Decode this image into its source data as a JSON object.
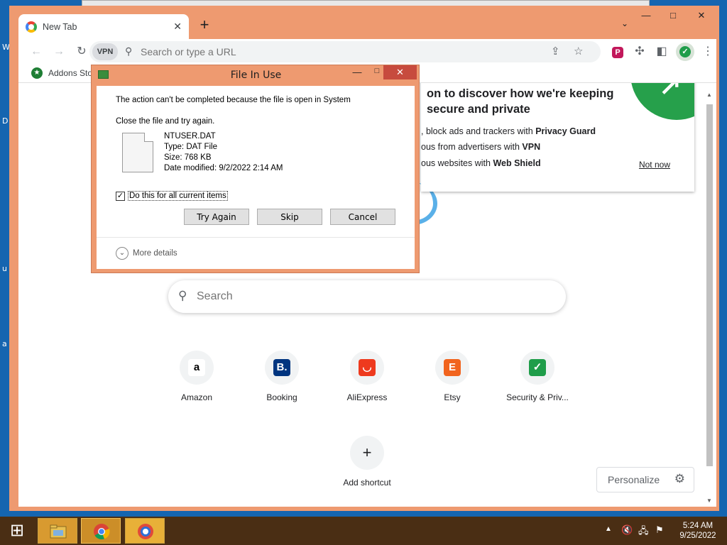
{
  "desktop": {
    "edge_letters": [
      "W",
      "D",
      "u",
      "a"
    ]
  },
  "browser": {
    "tab": {
      "title": "New Tab",
      "close": "✕"
    },
    "new_tab": "+",
    "tab_menu": "⌄",
    "window_controls": {
      "minimize": "—",
      "maximize": "□",
      "close": "✕"
    },
    "toolbar": {
      "back": "←",
      "forward": "→",
      "reload": "↻",
      "vpn_badge": "VPN",
      "omnibox_placeholder": "Search or type a URL",
      "share": "⇪",
      "bookmark_star": "☆",
      "extension_p": "P",
      "extensions": "✣",
      "side_panel": "◧",
      "shield": "✓",
      "menu": "⋮"
    },
    "bookmarks": [
      {
        "label": "Addons Store"
      }
    ],
    "vpn_popup": {
      "title_line1": "on to discover how we're keeping",
      "title_line2": "secure and private",
      "line1_text": ", block ads and trackers with ",
      "line1_bold": "Privacy Guard",
      "line2_text": "ous from advertisers with ",
      "line2_bold": "VPN",
      "line3_text": "ous websites with ",
      "line3_bold": "Web Shield",
      "not_now": "Not now",
      "arrow": "↗"
    },
    "ntp": {
      "search_placeholder": "Search",
      "shortcuts": [
        {
          "label": "Amazon",
          "glyph": "a",
          "color": "#ffffff",
          "text_color": "#000000"
        },
        {
          "label": "Booking",
          "glyph": "B.",
          "color": "#003580",
          "text_color": "#ffffff"
        },
        {
          "label": "AliExpress",
          "glyph": "◡",
          "color": "#ee3a1e",
          "text_color": "#ffffff"
        },
        {
          "label": "Etsy",
          "glyph": "E",
          "color": "#f1641e",
          "text_color": "#ffffff"
        },
        {
          "label": "Security & Priv...",
          "glyph": "✓",
          "color": "#1f9d4a",
          "text_color": "#ffffff"
        }
      ],
      "add_shortcut": {
        "label": "Add shortcut",
        "glyph": "+"
      },
      "personalize": "Personalize",
      "personalize_icon": "⚙"
    }
  },
  "dialog": {
    "title": "File In Use",
    "minimize": "—",
    "maximize": "□",
    "close": "✕",
    "message": "The action can't be completed because the file is open in System",
    "instruction": "Close the file and try again.",
    "file": {
      "name": "NTUSER.DAT",
      "type": "Type: DAT File",
      "size": "Size: 768 KB",
      "modified": "Date modified: 9/2/2022 2:14 AM"
    },
    "checkbox": {
      "label": "Do this for all current items",
      "checked": true,
      "mark": "✓"
    },
    "buttons": {
      "try_again": "Try Again",
      "skip": "Skip",
      "cancel": "Cancel"
    },
    "more_details": "More details",
    "more_chevron": "⌄"
  },
  "taskbar": {
    "start": "⊞",
    "tray_chevron": "▲",
    "tray_icons": [
      "🔇",
      "🖧",
      "⚑"
    ],
    "time": "5:24 AM",
    "date": "9/25/2022"
  }
}
